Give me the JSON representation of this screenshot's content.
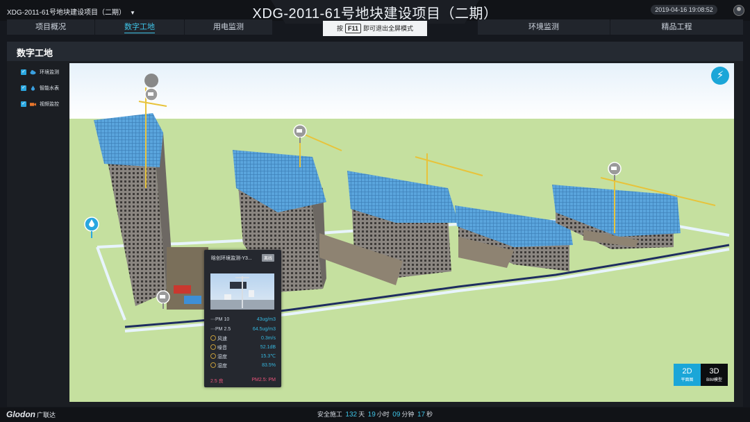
{
  "header": {
    "project_select": "XDG-2011-61号地块建设项目（二期）",
    "title": "XDG-2011-61号地块建设项目（二期）",
    "datetime": "2019-04-16 19:08:52"
  },
  "nav": {
    "tabs": [
      {
        "label": "项目概况",
        "active": false
      },
      {
        "label": "数字工地",
        "active": true
      },
      {
        "label": "用电监测",
        "active": false
      },
      {
        "label": "环境监测",
        "active": false
      },
      {
        "label": "精品工程",
        "active": false
      }
    ],
    "fullscreen_tip": {
      "prefix": "按",
      "key": "F11",
      "suffix": "即可退出全屏模式"
    }
  },
  "section": {
    "title": "数字工地"
  },
  "layers": [
    {
      "label": "环境监测",
      "checked": true,
      "icon": "cloud-icon",
      "color": "#3aa0e0"
    },
    {
      "label": "智能水表",
      "checked": true,
      "icon": "water-drop-icon",
      "color": "#3aa0e0"
    },
    {
      "label": "视频监控",
      "checked": true,
      "icon": "camera-icon",
      "color": "#e8762c"
    }
  ],
  "tooltip": {
    "title": "晗创环境监测-Y3...",
    "badge": "离线",
    "readings": [
      {
        "label": "PM 10",
        "value": "43ug/m3",
        "icon": "pm10-icon"
      },
      {
        "label": "PM 2.5",
        "value": "64.5ug/m3",
        "icon": "pm25-icon"
      },
      {
        "label": "风速",
        "value": "0.3m/s",
        "icon": "wind-icon"
      },
      {
        "label": "噪音",
        "value": "52.1dB",
        "icon": "noise-icon"
      },
      {
        "label": "湿度",
        "value": "15.3℃",
        "icon": "temperature-icon"
      },
      {
        "label": "湿度",
        "value": "83.5%",
        "icon": "humidity-icon"
      }
    ],
    "footer_left": "2.5 良",
    "footer_right": "PM2.5: PM"
  },
  "view_toggle": {
    "d2": {
      "big": "2D",
      "small": "平面图",
      "active": true
    },
    "d3": {
      "big": "3D",
      "small": "BIM模型",
      "active": false
    }
  },
  "footer": {
    "brand": "Glodon",
    "brand_cn": "广联达",
    "safety_prefix": "安全施工",
    "days": "132",
    "days_unit": "天",
    "hours": "19",
    "hours_unit": "小时",
    "minutes": "09",
    "minutes_unit": "分钟",
    "seconds": "17",
    "seconds_unit": "秒"
  },
  "colors": {
    "accent": "#3ec3e6",
    "building_glass": "#5aa5dd",
    "ground": "#c5e09f",
    "alert": "#e8537a"
  }
}
